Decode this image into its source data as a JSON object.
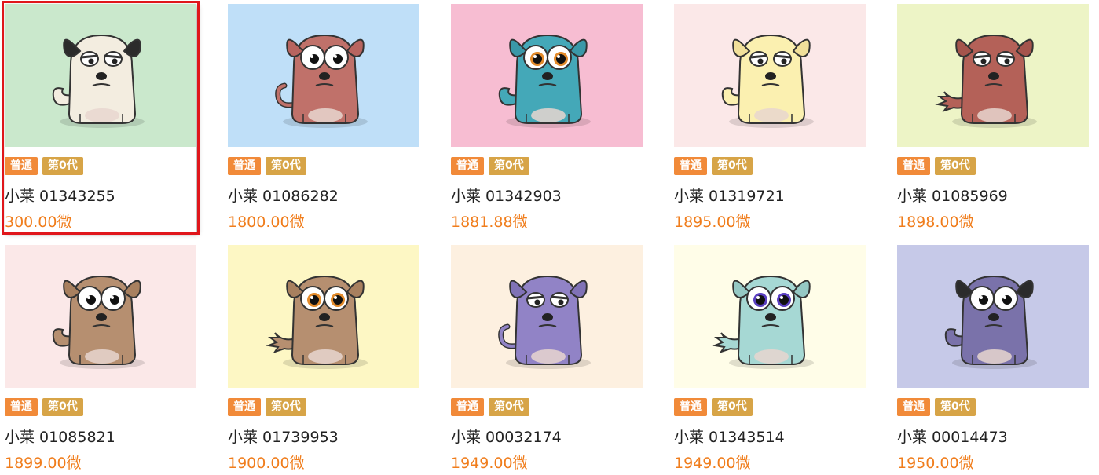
{
  "dogs": [
    {
      "name": "小莱 01343255",
      "price": "300.00微",
      "rarity": "普通",
      "generation": "第0代",
      "bg": "#cae8cc",
      "body": "#f3ede0",
      "ear": "#2b2b2b",
      "tail": "curl",
      "eyes": "sleepy",
      "selected": true
    },
    {
      "name": "小莱 01086282",
      "price": "1800.00微",
      "rarity": "普通",
      "generation": "第0代",
      "bg": "#bfdff8",
      "body": "#c0716a",
      "ear": "#b8645f",
      "tail": "thin",
      "eyes": "big",
      "selected": false
    },
    {
      "name": "小莱 01342903",
      "price": "1881.88微",
      "rarity": "普通",
      "generation": "第0代",
      "bg": "#f7bdd2",
      "body": "#44a8b8",
      "ear": "#3a98a8",
      "tail": "curl",
      "eyes": "orange",
      "selected": false
    },
    {
      "name": "小莱 01319721",
      "price": "1895.00微",
      "rarity": "普通",
      "generation": "第0代",
      "bg": "#fbe8e8",
      "body": "#fbf0b0",
      "ear": "#f1e09a",
      "tail": "curl",
      "eyes": "sleepy",
      "selected": false
    },
    {
      "name": "小莱 01085969",
      "price": "1898.00微",
      "rarity": "普通",
      "generation": "第0代",
      "bg": "#edf4c6",
      "body": "#b46158",
      "ear": "#a5544c",
      "tail": "fluffy",
      "eyes": "sleepy",
      "selected": false
    },
    {
      "name": "小莱 01085821",
      "price": "1899.00微",
      "rarity": "普通",
      "generation": "第0代",
      "bg": "#fbe8e8",
      "body": "#b68f70",
      "ear": "#a8805f",
      "tail": "curl",
      "eyes": "big",
      "selected": false
    },
    {
      "name": "小莱 01739953",
      "price": "1900.00微",
      "rarity": "普通",
      "generation": "第0代",
      "bg": "#fdf7c4",
      "body": "#b68f70",
      "ear": "#a8805f",
      "tail": "fluffy",
      "eyes": "orange",
      "selected": false
    },
    {
      "name": "小莱 00032174",
      "price": "1949.00微",
      "rarity": "普通",
      "generation": "第0代",
      "bg": "#fdf0e0",
      "body": "#9183c6",
      "ear": "#8072b6",
      "tail": "thin",
      "eyes": "sleepy",
      "selected": false
    },
    {
      "name": "小莱 01343514",
      "price": "1949.00微",
      "rarity": "普通",
      "generation": "第0代",
      "bg": "#fffde8",
      "body": "#a6d8d4",
      "ear": "#95c8c4",
      "tail": "fluffy",
      "eyes": "purple",
      "selected": false
    },
    {
      "name": "小莱 00014473",
      "price": "1950.00微",
      "rarity": "普通",
      "generation": "第0代",
      "bg": "#c6c9e8",
      "body": "#7a72aa",
      "ear": "#2b2b2b",
      "tail": "curl",
      "eyes": "big",
      "selected": false
    }
  ]
}
